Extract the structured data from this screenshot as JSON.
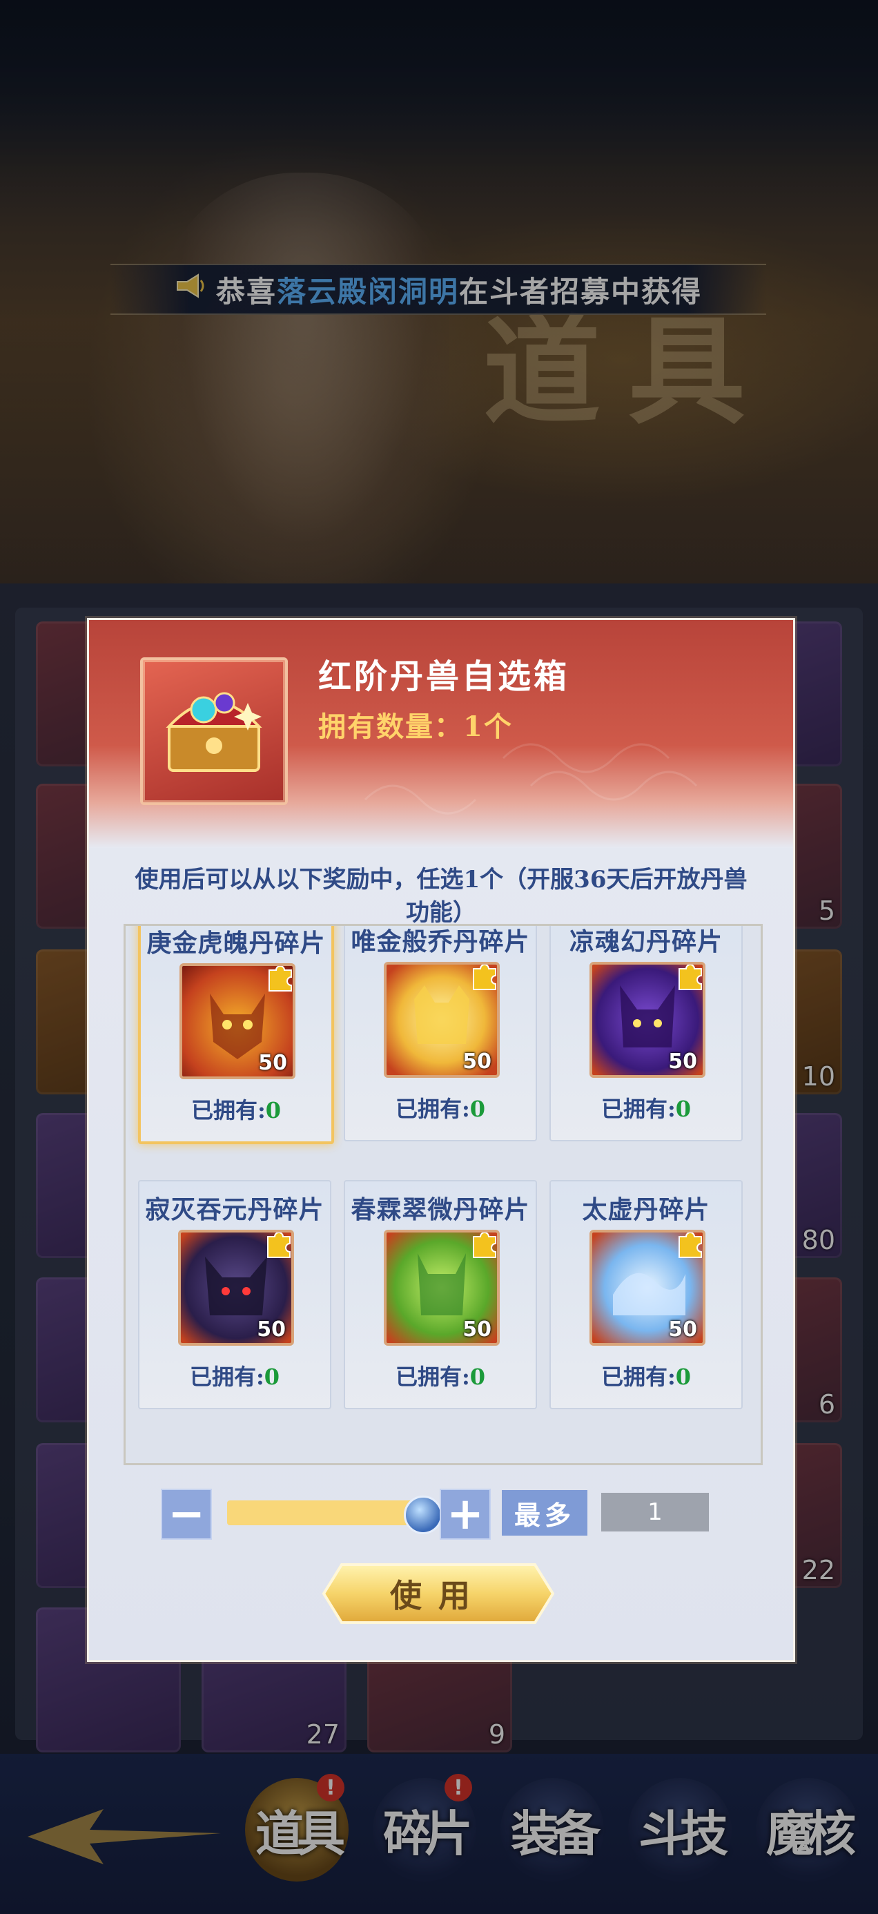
{
  "banner": {
    "prefix": "恭喜",
    "player_name": "落云殿闵洞明",
    "suffix": "在斗者招募中获得"
  },
  "background": {
    "page_watermark": "道具",
    "tile_counts": [
      "5",
      "10",
      "80",
      "6",
      "22",
      "27",
      "9"
    ]
  },
  "dialog": {
    "item_name": "红阶丹兽自选箱",
    "owned_label": "拥有数量：1个",
    "description": "使用后可以从以下奖励中，任选1个（开服36天后开放丹兽功能）",
    "rewards": [
      {
        "name": "庚金虎魄丹碎片",
        "count": "50",
        "owned_label": "已拥有:",
        "owned_value": "0",
        "selected": true
      },
      {
        "name": "唯金般乔丹碎片",
        "count": "50",
        "owned_label": "已拥有:",
        "owned_value": "0",
        "selected": false
      },
      {
        "name": "凉魂幻丹碎片",
        "count": "50",
        "owned_label": "已拥有:",
        "owned_value": "0",
        "selected": false
      },
      {
        "name": "寂灭吞元丹碎片",
        "count": "50",
        "owned_label": "已拥有:",
        "owned_value": "0",
        "selected": false
      },
      {
        "name": "春霖翠微丹碎片",
        "count": "50",
        "owned_label": "已拥有:",
        "owned_value": "0",
        "selected": false
      },
      {
        "name": "太虚丹碎片",
        "count": "50",
        "owned_label": "已拥有:",
        "owned_value": "0",
        "selected": false
      }
    ],
    "quantity": {
      "minus": "−",
      "plus": "+",
      "max_label": "最多",
      "value": "1",
      "slider_fraction": 1.0
    },
    "use_label": "使用"
  },
  "bottom_nav": {
    "items": [
      {
        "label": "道具",
        "badge": "!",
        "active": true
      },
      {
        "label": "碎片",
        "badge": "!",
        "active": false
      },
      {
        "label": "装备",
        "badge": "",
        "active": false
      },
      {
        "label": "斗技",
        "badge": "",
        "active": false
      },
      {
        "label": "魔核",
        "badge": "",
        "active": false
      }
    ]
  },
  "colors": {
    "header_red": "#c64a3e",
    "title_gold": "#ffd36a",
    "text_blue": "#2f4a86",
    "owned_green": "#1b9a3a",
    "slider_gold": "#f9d779",
    "button_blue": "#8fa7dc"
  }
}
